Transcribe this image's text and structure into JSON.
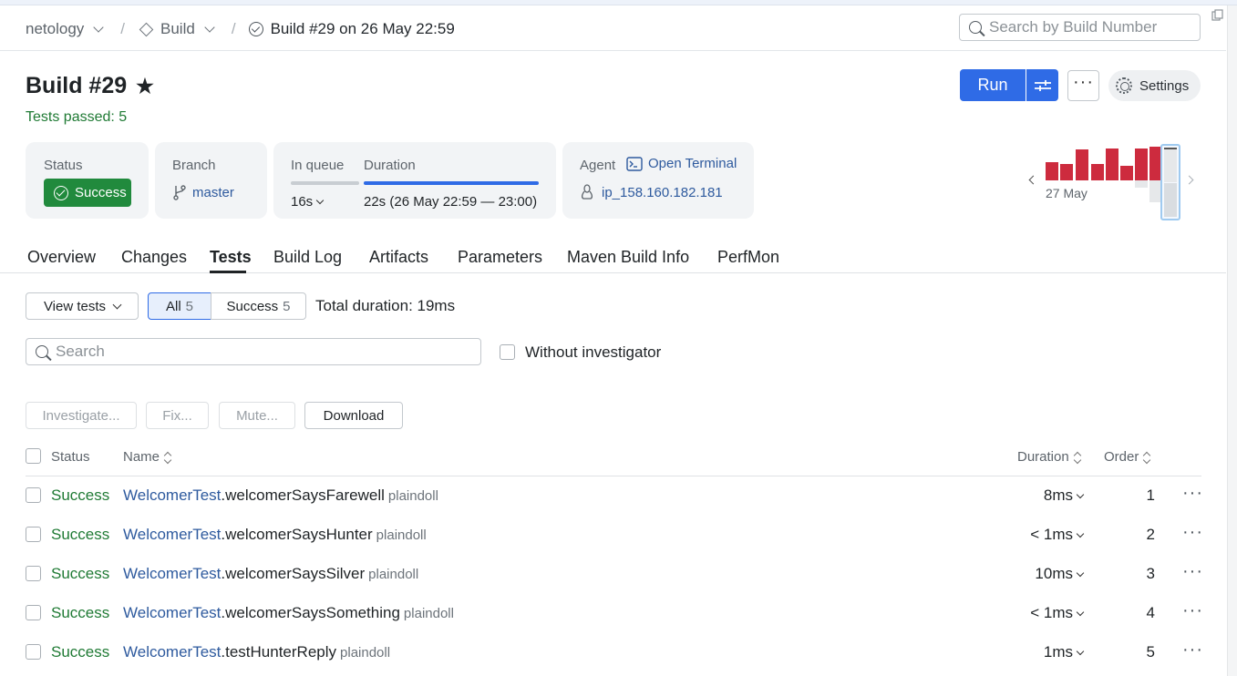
{
  "breadcrumbs": {
    "project": "netology",
    "build_config": "Build",
    "build": "Build #29 on 26 May 22:59"
  },
  "search_build": {
    "placeholder": "Search by Build Number"
  },
  "header": {
    "title": "Build #29",
    "tests_passed": "Tests passed: 5",
    "run_label": "Run",
    "more_label": "···",
    "settings_label": "Settings"
  },
  "summary": {
    "status_label": "Status",
    "status_value": "Success",
    "branch_label": "Branch",
    "branch_value": "master",
    "queue_label": "In queue",
    "queue_value": "16s",
    "duration_label": "Duration",
    "duration_value": "22s (26 May 22:59 — 23:00)",
    "agent_label": "Agent",
    "open_terminal": "Open Terminal",
    "agent_name": "ip_158.160.182.181"
  },
  "history": {
    "date_label": "27 May"
  },
  "tabs": [
    {
      "label": "Overview"
    },
    {
      "label": "Changes"
    },
    {
      "label": "Tests",
      "active": true
    },
    {
      "label": "Build Log"
    },
    {
      "label": "Artifacts"
    },
    {
      "label": "Parameters"
    },
    {
      "label": "Maven Build Info"
    },
    {
      "label": "PerfMon"
    }
  ],
  "toolbar": {
    "view_tests": "View tests",
    "all_label": "All",
    "all_count": "5",
    "success_label": "Success",
    "success_count": "5",
    "total_duration": "Total duration: 19ms",
    "search_placeholder": "Search",
    "without_investigator": "Without investigator",
    "investigate": "Investigate...",
    "fix": "Fix...",
    "mute": "Mute...",
    "download": "Download"
  },
  "table": {
    "headers": {
      "status": "Status",
      "name": "Name",
      "duration": "Duration",
      "order": "Order"
    },
    "rows": [
      {
        "status": "Success",
        "class": "WelcomerTest",
        "method": ".welcomerSaysFarewell",
        "user": "plaindoll",
        "duration": "8ms",
        "order": "1"
      },
      {
        "status": "Success",
        "class": "WelcomerTest",
        "method": ".welcomerSaysHunter",
        "user": "plaindoll",
        "duration": "< 1ms",
        "order": "2"
      },
      {
        "status": "Success",
        "class": "WelcomerTest",
        "method": ".welcomerSaysSilver",
        "user": "plaindoll",
        "duration": "10ms",
        "order": "3"
      },
      {
        "status": "Success",
        "class": "WelcomerTest",
        "method": ".welcomerSaysSomething",
        "user": "plaindoll",
        "duration": "< 1ms",
        "order": "4"
      },
      {
        "status": "Success",
        "class": "WelcomerTest",
        "method": ".testHunterReply",
        "user": "plaindoll",
        "duration": "1ms",
        "order": "5"
      }
    ]
  },
  "colors": {
    "accent": "#2f6be6",
    "success": "#218a3d",
    "failed_bar": "#cd2b3e",
    "link": "#2e5a9e"
  }
}
